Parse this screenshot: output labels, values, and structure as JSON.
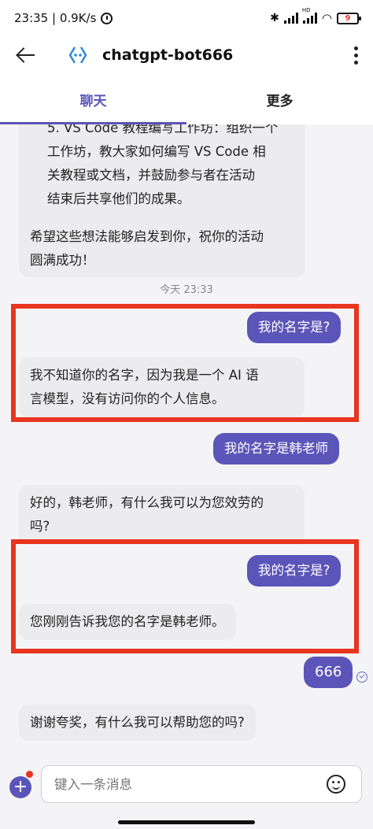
{
  "status_bar": {
    "time_speed": "23:35 | 0.9K/s",
    "network_label": "HD",
    "battery_level": "9"
  },
  "header": {
    "title": "chatgpt-bot666"
  },
  "tabs": [
    {
      "label": "聊天",
      "active": true
    },
    {
      "label": "更多",
      "active": false
    }
  ],
  "messages": {
    "m1_lines": [
      "5. VS Code 教程编写工作坊：组织一个",
      "工作坊，教大家如何编写 VS Code 相",
      "关教程或文档，并鼓励参与者在活动",
      "结束后共享他们的成果。",
      "",
      "希望这些想法能够启发到你，祝你的活动",
      "圆满成功！"
    ],
    "time_separator": "今天 23:33",
    "m2": "我的名字是?",
    "m3_lines": [
      "我不知道你的名字，因为我是一个 AI 语",
      "言模型，没有访问你的个人信息。"
    ],
    "m4": "我的名字是韩老师",
    "m5_lines": [
      "好的，韩老师，有什么我可以为您效劳的",
      "吗?"
    ],
    "m6": "我的名字是?",
    "m7": "您刚刚告诉我您的名字是韩老师。",
    "m8": "666",
    "m9": "谢谢夸奖，有什么我可以帮助您的吗?"
  },
  "input": {
    "placeholder": "键入一条消息"
  },
  "colors": {
    "accent": "#5b55b9",
    "highlight": "#e8351f",
    "bot_bubble": "#ececee"
  }
}
